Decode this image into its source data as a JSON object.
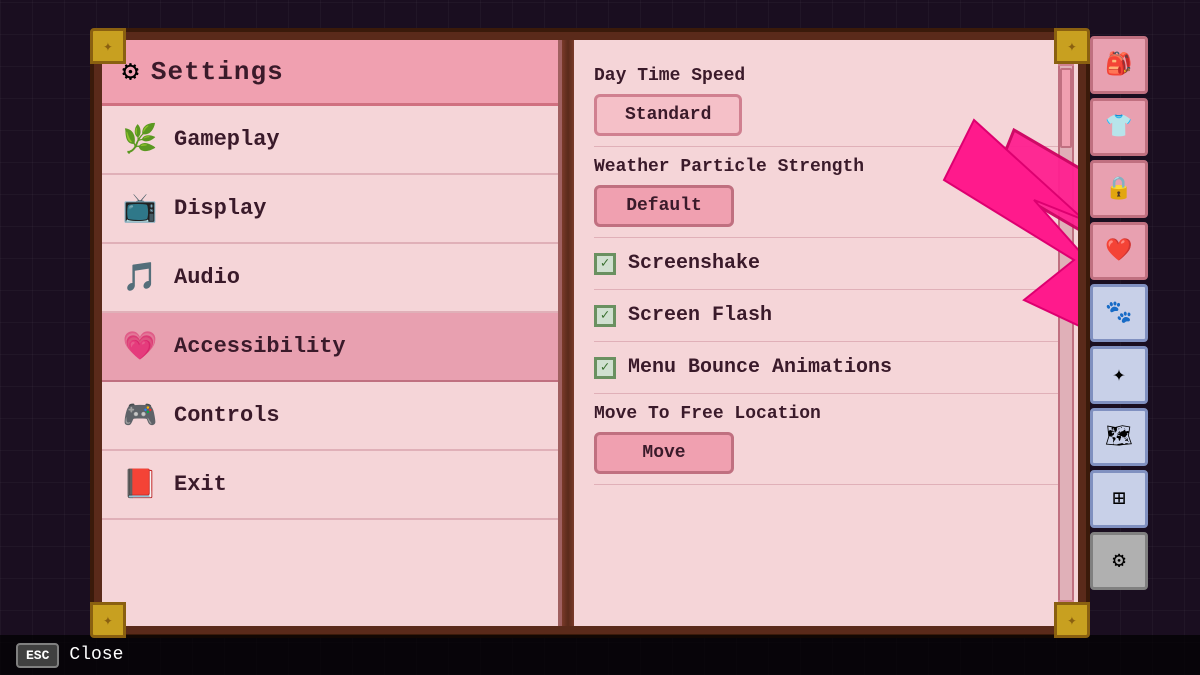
{
  "background": {
    "color": "#1a0e20"
  },
  "settings": {
    "title": "Settings",
    "nav_items": [
      {
        "id": "gameplay",
        "label": "Gameplay",
        "icon": "🌿",
        "active": false
      },
      {
        "id": "display",
        "label": "Display",
        "icon": "📺",
        "active": false
      },
      {
        "id": "audio",
        "label": "Audio",
        "icon": "🎵",
        "active": false
      },
      {
        "id": "accessibility",
        "label": "Accessibility",
        "icon": "💗",
        "active": true
      },
      {
        "id": "controls",
        "label": "Controls",
        "icon": "🎮",
        "active": false
      },
      {
        "id": "exit",
        "label": "Exit",
        "icon": "📕",
        "active": false
      }
    ]
  },
  "right_panel": {
    "sections": [
      {
        "id": "day-time-speed",
        "label": "Day Time Speed",
        "type": "button",
        "button_label": "Standard"
      },
      {
        "id": "weather-particle",
        "label": "Weather Particle Strength",
        "type": "button",
        "button_label": "Default"
      },
      {
        "id": "screenshake",
        "label": "Screenshake",
        "type": "checkbox",
        "checked": true
      },
      {
        "id": "screen-flash",
        "label": "Screen Flash",
        "type": "checkbox",
        "checked": true
      },
      {
        "id": "menu-bounce",
        "label": "Menu Bounce Animations",
        "type": "checkbox",
        "checked": true
      },
      {
        "id": "move-to-free",
        "label": "Move To Free Location",
        "type": "button",
        "button_label": "Move"
      }
    ]
  },
  "sidebar_icons": [
    {
      "id": "backpack",
      "icon": "🎒",
      "active": false
    },
    {
      "id": "shirt",
      "icon": "👕",
      "active": false
    },
    {
      "id": "lock",
      "icon": "🔒",
      "active": false
    },
    {
      "id": "heart",
      "icon": "❤️",
      "active": false
    },
    {
      "id": "paw",
      "icon": "🐾",
      "active": false
    },
    {
      "id": "compass",
      "icon": "✦",
      "active": false
    },
    {
      "id": "map",
      "icon": "🗺",
      "active": false
    },
    {
      "id": "grid",
      "icon": "⊞",
      "active": false
    },
    {
      "id": "gear",
      "icon": "⚙",
      "active": true
    }
  ],
  "footer": {
    "esc_label": "ESC",
    "close_label": "Close"
  }
}
